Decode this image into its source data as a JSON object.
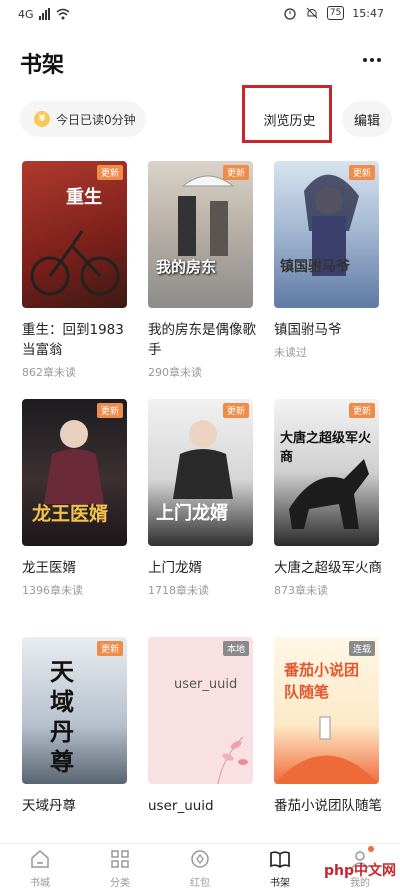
{
  "status": {
    "network": "4G",
    "battery": "75",
    "time": "15:47"
  },
  "header": {
    "title": "书架"
  },
  "toolbar": {
    "reading_label": "今日已读0分钟",
    "history_label": "浏览历史",
    "edit_label": "编辑"
  },
  "books": [
    {
      "title": "重生：回到1983当富翁",
      "subtitle": "862章未读",
      "badge": "更新",
      "cover_text": "重生",
      "badge_color": "#f08c4a"
    },
    {
      "title": "我的房东是偶像歌手",
      "subtitle": "290章未读",
      "badge": "更新",
      "cover_text": "我的房东",
      "badge_color": "#f08c4a"
    },
    {
      "title": "镇国驸马爷",
      "subtitle": "未读过",
      "badge": "更新",
      "cover_text": "镇国驸马爷",
      "badge_color": "#f08c4a"
    },
    {
      "title": "龙王医婿",
      "subtitle": "1396章未读",
      "badge": "更新",
      "cover_text": "龙王医婿",
      "badge_color": "#f08c4a"
    },
    {
      "title": "上门龙婿",
      "subtitle": "1718章未读",
      "badge": "更新",
      "cover_text": "上门龙婿",
      "badge_color": "#f08c4a"
    },
    {
      "title": "大唐之超级军火商",
      "subtitle": "873章未读",
      "badge": "更新",
      "cover_text": "大唐之超级军火商",
      "badge_color": "#f08c4a"
    },
    {
      "title": "天域丹尊",
      "subtitle": "",
      "badge": "更新",
      "cover_text": "天域丹尊",
      "badge_color": "#f08c4a"
    },
    {
      "title": "user_uuid",
      "subtitle": "",
      "badge": "本地",
      "cover_text": "user_uuid",
      "badge_color": "#8a8a8a"
    },
    {
      "title": "番茄小说团队随笔",
      "subtitle": "",
      "badge": "连载",
      "cover_text": "番茄小说团队随笔",
      "badge_color": "#8a8a8a"
    }
  ],
  "tabs": [
    {
      "label": "书城",
      "icon": "home-icon"
    },
    {
      "label": "分类",
      "icon": "grid-icon"
    },
    {
      "label": "红包",
      "icon": "redpacket-icon"
    },
    {
      "label": "书架",
      "icon": "book-icon"
    },
    {
      "label": "我的",
      "icon": "user-icon"
    }
  ],
  "watermark": "php中文网",
  "colors": {
    "highlight_border": "#c8252c",
    "badge_orange": "#f08c4a",
    "badge_gray": "#8a8a8a"
  }
}
